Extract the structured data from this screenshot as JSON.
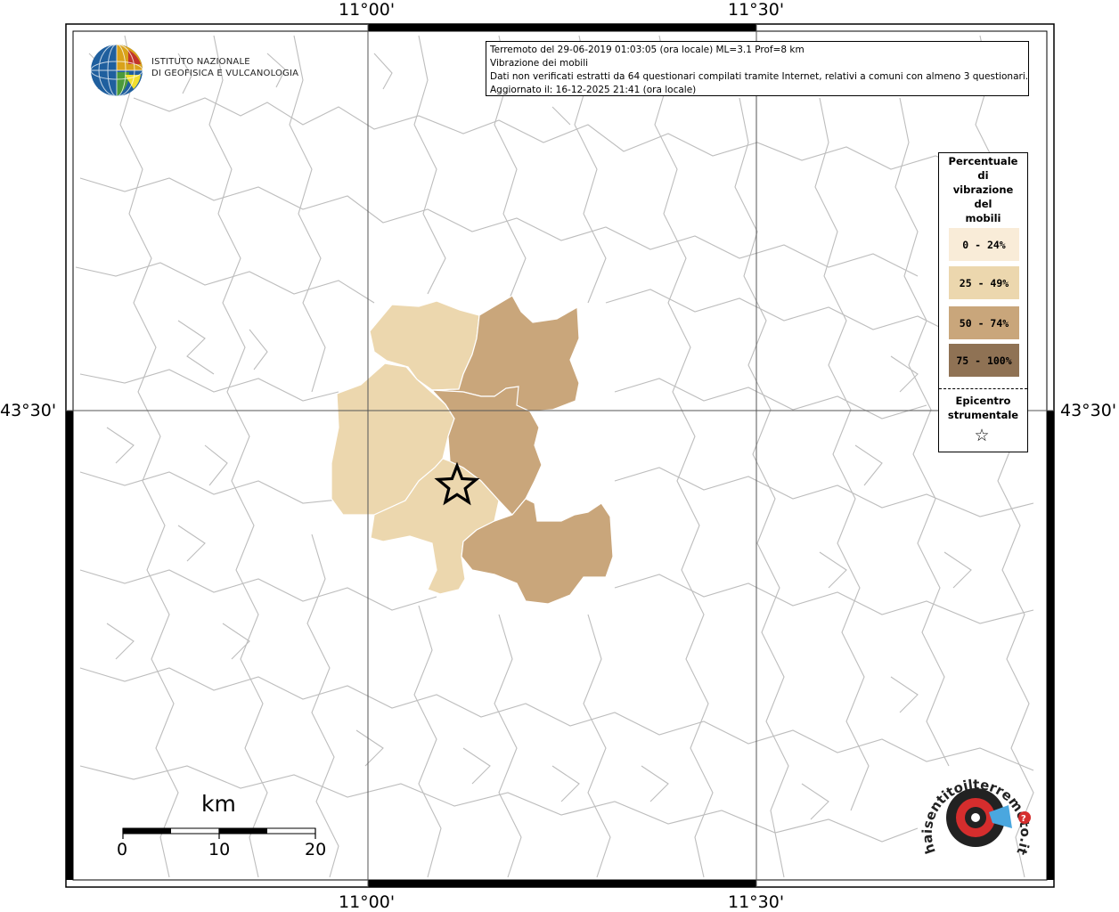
{
  "info": {
    "line1": "Terremoto del 29-06-2019 01:03:05 (ora locale) ML=3.1 Prof=8 km",
    "line2": "Vibrazione dei mobili",
    "line3": "Dati non verificati estratti da 64 questionari compilati tramite Internet, relativi a comuni con almeno 3 questionari.",
    "line4": "Aggiornato il: 16-12-2025 21:41 (ora locale)"
  },
  "logo": {
    "line1": "ISTITUTO NAZIONALE",
    "line2": "DI GEOFISICA E VULCANOLOGIA"
  },
  "legend": {
    "title": "Percentuale di vibrazione del mobili",
    "title_lines": [
      "Percentuale",
      "di",
      "vibrazione",
      "del",
      "mobili"
    ],
    "items": [
      {
        "label": "0 - 24%",
        "color": "#f9ecd8"
      },
      {
        "label": "25 - 49%",
        "color": "#ecd7ae"
      },
      {
        "label": "50 - 74%",
        "color": "#c9a67b"
      },
      {
        "label": "75 - 100%",
        "color": "#8f7254"
      }
    ],
    "epicenter_label_1": "Epicentro",
    "epicenter_label_2": "strumentale",
    "epicenter_symbol": "☆"
  },
  "axes": {
    "lon_ticks": [
      "11°00'",
      "11°30'"
    ],
    "lat_tick": "43°30'"
  },
  "scale_bar": {
    "unit": "km",
    "labels": [
      "0",
      "10",
      "20"
    ]
  },
  "watermark": {
    "text": "haisentitoilterremoto.it",
    "url_text": "www."
  },
  "colors": {
    "boundary": "#bdbdbd",
    "grid": "#555555"
  }
}
